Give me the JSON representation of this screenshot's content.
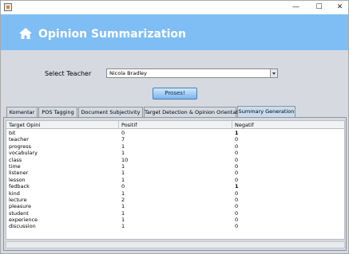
{
  "window": {
    "minimize_glyph": "—",
    "maximize_glyph": "☐",
    "close_glyph": "✕"
  },
  "header": {
    "icon": "home-icon",
    "title": "Opinion Summarization",
    "color": "#7fbef4"
  },
  "teacher": {
    "label": "Select Teacher",
    "selected": "Nicola Bradley"
  },
  "proses_button": "Proses!",
  "tabs": [
    {
      "label": "Komentar",
      "active": false
    },
    {
      "label": "POS Tagging",
      "active": false
    },
    {
      "label": "Document Subjectivity",
      "active": false
    },
    {
      "label": "Target Detection & Opinion Orientation",
      "active": false
    },
    {
      "label": "Summary Generation",
      "active": true
    }
  ],
  "table": {
    "headers": [
      "Target Opini",
      "Positif",
      "Negatif"
    ],
    "rows": [
      {
        "target": "bit",
        "positif": "0",
        "negatif": "1",
        "neg_bold": true
      },
      {
        "target": "teacher",
        "positif": "7",
        "negatif": "0",
        "neg_bold": false
      },
      {
        "target": "progress",
        "positif": "1",
        "negatif": "0",
        "neg_bold": false
      },
      {
        "target": "vocabulary",
        "positif": "1",
        "negatif": "0",
        "neg_bold": false
      },
      {
        "target": "class",
        "positif": "10",
        "negatif": "0",
        "neg_bold": false
      },
      {
        "target": "time",
        "positif": "1",
        "negatif": "0",
        "neg_bold": false
      },
      {
        "target": "listener",
        "positif": "1",
        "negatif": "0",
        "neg_bold": false
      },
      {
        "target": "lesson",
        "positif": "1",
        "negatif": "0",
        "neg_bold": false
      },
      {
        "target": "fedback",
        "positif": "0",
        "negatif": "1",
        "neg_bold": true
      },
      {
        "target": "kind",
        "positif": "1",
        "negatif": "0",
        "neg_bold": false
      },
      {
        "target": "lecture",
        "positif": "2",
        "negatif": "0",
        "neg_bold": false
      },
      {
        "target": "pleasure",
        "positif": "1",
        "negatif": "0",
        "neg_bold": false
      },
      {
        "target": "student",
        "positif": "1",
        "negatif": "0",
        "neg_bold": false
      },
      {
        "target": "experience",
        "positif": "1",
        "negatif": "0",
        "neg_bold": false
      },
      {
        "target": "discussion",
        "positif": "1",
        "negatif": "0",
        "neg_bold": false
      }
    ]
  }
}
